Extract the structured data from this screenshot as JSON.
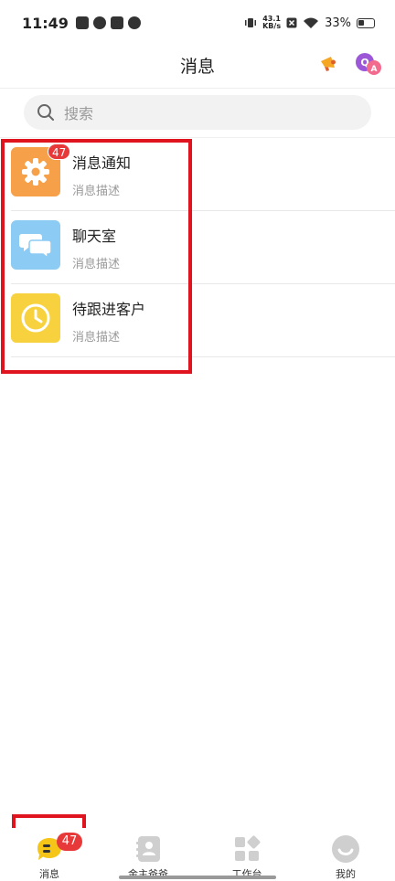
{
  "status_bar": {
    "time": "11:49",
    "net_speed_value": "43.1",
    "net_speed_unit": "KB/s",
    "battery": "33%"
  },
  "header": {
    "title": "消息"
  },
  "search": {
    "placeholder": "搜索"
  },
  "messages": [
    {
      "title": "消息通知",
      "desc": "消息描述",
      "badge": "47",
      "icon": "gear-icon",
      "color": "#F7A04A"
    },
    {
      "title": "聊天室",
      "desc": "消息描述",
      "icon": "chat-bubbles-icon",
      "color": "#8CCBF3"
    },
    {
      "title": "待跟进客户",
      "desc": "消息描述",
      "icon": "clock-icon",
      "color": "#F7D23E"
    }
  ],
  "tabbar": {
    "items": [
      {
        "label": "消息",
        "badge": "47",
        "icon": "message-bubble-icon",
        "active_color": "#F5C518"
      },
      {
        "label": "金主爸爸",
        "icon": "contact-book-icon"
      },
      {
        "label": "工作台",
        "icon": "workbench-grid-icon"
      },
      {
        "label": "我的",
        "icon": "profile-face-icon"
      }
    ]
  },
  "colors": {
    "badge": "#E8393A",
    "annotation": "#E0141E"
  }
}
